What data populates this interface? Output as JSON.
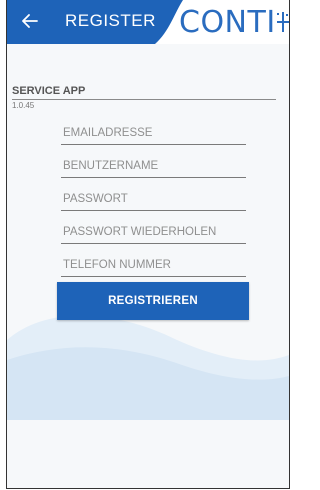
{
  "header": {
    "title": "REGISTER",
    "logo_text": "CONTI",
    "logo_mark": "+"
  },
  "service": {
    "label": "SERVICE APP",
    "version": "1.0.45"
  },
  "form": {
    "email_placeholder": "EMAILADRESSE",
    "username_placeholder": "BENUTZERNAME",
    "password_placeholder": "PASSWORT",
    "password_repeat_placeholder": "PASSWORT WIEDERHOLEN",
    "phone_placeholder": "TELEFON NUMMER",
    "submit_label": "REGISTRIEREN"
  },
  "icons": {
    "back": "back-arrow-icon",
    "logo": "conti-logo-icon"
  },
  "colors": {
    "primary": "#1e63b8",
    "logo_blue": "#2a6cbf",
    "wave": "#dce9f6",
    "background": "#f6f8fa"
  }
}
